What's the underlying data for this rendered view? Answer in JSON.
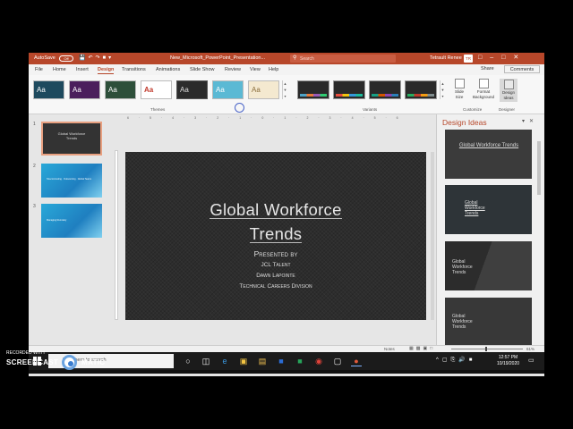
{
  "titlebar": {
    "autosave": "AutoSave",
    "toggle_state": "Off",
    "doc_name": "New_Microsoft_PowerPoint_Presentation...",
    "search": "Search",
    "user": "Tetrault Renee",
    "user_initials": "TR"
  },
  "menu": {
    "tabs": [
      "File",
      "Home",
      "Insert",
      "Design",
      "Transitions",
      "Animations",
      "Slide Show",
      "Review",
      "View",
      "Help"
    ],
    "active": "Design",
    "share": "Share",
    "comments": "Comments"
  },
  "ribbon": {
    "themes_label": "Themes",
    "variants_label": "Variants",
    "customize_label": "Customize",
    "designer_label": "Designer",
    "theme_glyph": "Aa",
    "slide_size": "Slide Size",
    "format_background": "Format Background",
    "design_ideas": "Design Ideas",
    "theme_colors": [
      "#1e4a5e",
      "#4b1f5c",
      "#2d4f3a",
      "#ffffff",
      "#2b2b2b",
      "#5bb9d4",
      "#f4e9d0"
    ],
    "variant_stripes": [
      "#4da3c7",
      "#e87a3a",
      "#9b59b6",
      "#2ecc71"
    ]
  },
  "thumbnails": {
    "slide_1_title": "Global Workforce Trends",
    "slide_1_sub": "Presented by",
    "slide_2_text": "Telecommuting · Outsourcing · Global Teams",
    "slide_3_text": "Managing Remotely"
  },
  "slide": {
    "title_line1": "Global Workforce",
    "title_line2": "Trends",
    "presented_by": "Presented by",
    "company": "JCL Talent",
    "presenter": "Dawn Lapointe",
    "division": "Technical Careers Division"
  },
  "ideas": {
    "title": "Design Ideas",
    "card1_title": "Global Workforce Trends",
    "card2_title": "Global Workforce Trends",
    "card3_title": "Global Workforce Trends",
    "card4_title": "Global Workforce Trends"
  },
  "status": {
    "notes": "Notes",
    "zoom": "61%"
  },
  "taskbar": {
    "search_placeholder": "Type here to search",
    "time": "12:57 PM",
    "date": "10/19/2020"
  },
  "watermark": {
    "line1": "RECORDED WITH",
    "line2": "SCREENCAST",
    "line3": "MATIC"
  }
}
